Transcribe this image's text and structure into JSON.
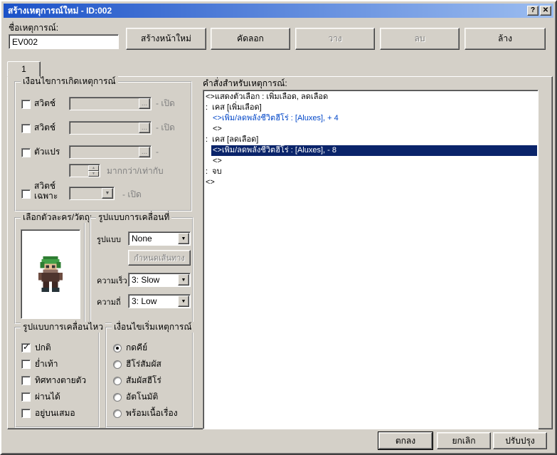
{
  "window": {
    "title": "สร้างเหตุการณ์ใหม่ - ID:002",
    "help_label": "?",
    "close_label": "✕"
  },
  "header": {
    "name_label": "ชื่อเหตุการณ์:",
    "name_value": "EV002",
    "new_page": "สร้างหน้าใหม่",
    "copy": "คัดลอก",
    "paste": "วาง",
    "delete": "ลบ",
    "clear": "ล้าง"
  },
  "tabs": [
    {
      "label": "1"
    }
  ],
  "conditions": {
    "title": "เงื่อนไขการเกิดเหตุการณ์",
    "browse_label": "...",
    "switch1": {
      "label": "สวิตช์",
      "suffix": "- เปิด",
      "checked": false
    },
    "switch2": {
      "label": "สวิตช์",
      "suffix": "- เปิด",
      "checked": false
    },
    "variable": {
      "label": "ตัวแปร",
      "suffix": "-",
      "checked": false
    },
    "compare_label": "มากกว่า/เท่ากับ",
    "self_switch": {
      "label_line1": "สวิตช์",
      "label_line2": "เฉพาะ",
      "suffix": "- เปิด",
      "checked": false
    }
  },
  "graphic": {
    "title": "เลือกตัวละคร/วัตถุ:"
  },
  "movement": {
    "title": "รูปแบบการเคลื่อนที่",
    "type_label": "รูปแบบ",
    "type_value": "None",
    "route_button": "กำหนดเส้นทาง",
    "speed_label": "ความเร็ว",
    "speed_value": "3: Slow",
    "freq_label": "ความถี่",
    "freq_value": "3: Low"
  },
  "options": {
    "title": "รูปแบบการเคลื่อนไหว",
    "items": [
      {
        "label": "ปกติ",
        "checked": true
      },
      {
        "label": "ย่ำเท้า",
        "checked": false
      },
      {
        "label": "ทิศทางตายตัว",
        "checked": false
      },
      {
        "label": "ผ่านได้",
        "checked": false
      },
      {
        "label": "อยู่บนเสมอ",
        "checked": false
      }
    ]
  },
  "trigger": {
    "title": "เงื่อนไขเริ่มเหตุการณ์",
    "items": [
      {
        "label": "กดคีย์",
        "selected": true
      },
      {
        "label": "ฮีโร่สัมผัส",
        "selected": false
      },
      {
        "label": "สัมผัสฮีโร่",
        "selected": false
      },
      {
        "label": "อัตโนมัติ",
        "selected": false
      },
      {
        "label": "พร้อมเนื้อเรื่อง",
        "selected": false
      }
    ]
  },
  "commands": {
    "title": "คำสั่งสำหรับเหตุการณ์:",
    "lines": [
      {
        "indent": 0,
        "text": "<>แสดงตัวเลือก : เพิ่มเลือด, ลดเลือด",
        "color": "black",
        "selected": false
      },
      {
        "indent": 0,
        "text": ":  เคส [เพิ่มเลือด]",
        "color": "black",
        "selected": false
      },
      {
        "indent": 1,
        "text": "<>เพิ่ม/ลดพลังชีวิตฮีโร่ : [Aluxes], + 4",
        "color": "blue",
        "selected": false
      },
      {
        "indent": 1,
        "text": "<>",
        "color": "black",
        "selected": false
      },
      {
        "indent": 0,
        "text": ":  เคส [ลดเลือด]",
        "color": "black",
        "selected": false
      },
      {
        "indent": 1,
        "text": "<>เพิ่ม/ลดพลังชีวิตฮีโร่ : [Aluxes], - 8",
        "color": "blue",
        "selected": true
      },
      {
        "indent": 1,
        "text": "<>",
        "color": "black",
        "selected": false
      },
      {
        "indent": 0,
        "text": ":  จบ",
        "color": "black",
        "selected": false
      },
      {
        "indent": 0,
        "text": "<>",
        "color": "black",
        "selected": false
      }
    ]
  },
  "footer": {
    "ok": "ตกลง",
    "cancel": "ยกเลิก",
    "apply": "ปรับปรุง"
  },
  "colors": {
    "titlebar_start": "#1c52c8",
    "titlebar_end": "#9cbdf0",
    "dialog_bg": "#d4d0c8",
    "selection_bg": "#0a246a",
    "command_blue": "#0046c8"
  }
}
